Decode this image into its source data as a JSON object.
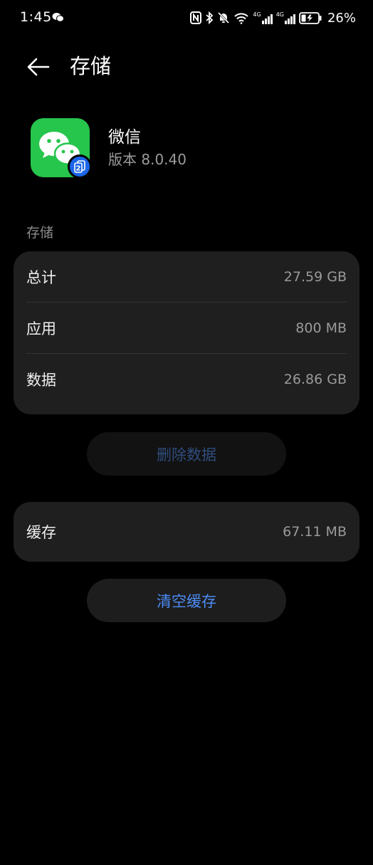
{
  "status_bar": {
    "time": "1:45",
    "network_1": "4G",
    "network_2": "4G",
    "battery": "26%"
  },
  "header": {
    "title": "存储"
  },
  "app": {
    "name": "微信",
    "version": "版本 8.0.40",
    "badge": "2",
    "icon_color": "#26c54c"
  },
  "storage": {
    "section_label": "存储",
    "rows": [
      {
        "label": "总计",
        "value": "27.59 GB"
      },
      {
        "label": "应用",
        "value": "800 MB"
      },
      {
        "label": "数据",
        "value": "26.86 GB"
      }
    ],
    "delete_button": "删除数据"
  },
  "cache": {
    "label": "缓存",
    "value": "67.11 MB",
    "clear_button": "清空缓存"
  },
  "colors": {
    "accent": "#4d8cf5",
    "card": "#1f1f1f",
    "background": "#000000"
  }
}
